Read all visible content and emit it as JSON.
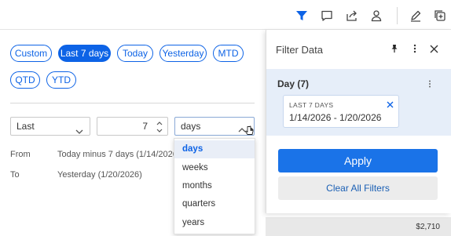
{
  "toolbar": {
    "icons": [
      "filter-icon",
      "comment-icon",
      "share-icon",
      "user-icon",
      "edit-icon",
      "add-widget-icon"
    ],
    "active_color": "#0d63e6"
  },
  "presets": {
    "items": [
      {
        "label": "Custom",
        "active": false
      },
      {
        "label": "Last 7 days",
        "active": true
      },
      {
        "label": "Today",
        "active": false
      },
      {
        "label": "Yesterday",
        "active": false
      },
      {
        "label": "MTD",
        "active": false
      },
      {
        "label": "QTD",
        "active": false
      },
      {
        "label": "YTD",
        "active": false
      }
    ]
  },
  "range": {
    "mode_value": "Last",
    "count_value": "7",
    "unit_value": "days"
  },
  "from_to": {
    "from_label": "From",
    "from_value": "Today minus 7 days (1/14/2026)",
    "to_label": "To",
    "to_value": "Yesterday (1/20/2026)"
  },
  "unit_dropdown": {
    "options": [
      "days",
      "weeks",
      "months",
      "quarters",
      "years"
    ],
    "selected": "days"
  },
  "side_panel": {
    "title": "Filter Data",
    "filter_title": "Day (7)",
    "card_caption": "LAST 7 DAYS",
    "card_range": "1/14/2026 - 1/20/2026",
    "apply_label": "Apply",
    "clear_label": "Clear All Filters"
  },
  "background": {
    "bottom_value": "$2,710"
  },
  "colors": {
    "accent": "#0d63e6",
    "apply_button": "#1a73e8",
    "panel_highlight": "#e6eef9"
  }
}
